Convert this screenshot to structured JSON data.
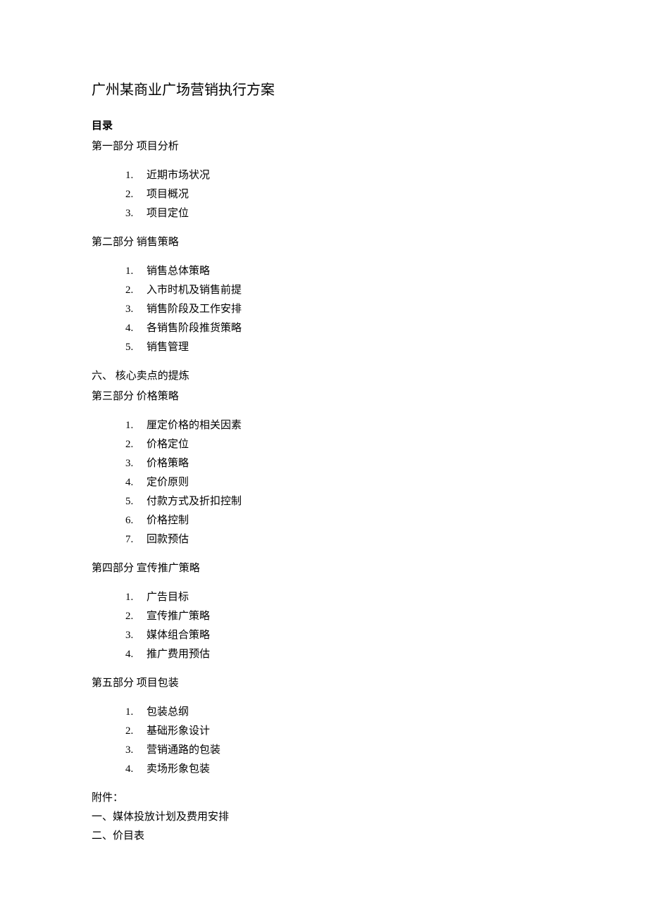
{
  "title": "广州某商业广场营销执行方案",
  "tocHeading": "目录",
  "sections": [
    {
      "heading": "第一部分 项目分析",
      "items": [
        "近期市场状况",
        "项目概况",
        "项目定位"
      ]
    },
    {
      "heading": "第二部分 销售策略",
      "items": [
        "销售总体策略",
        "入市时机及销售前提",
        "销售阶段及工作安排",
        "各销售阶段推货策略",
        "销售管理"
      ]
    }
  ],
  "extraLine": "六、 核心卖点的提炼",
  "sections2": [
    {
      "heading": "第三部分 价格策略",
      "items": [
        "厘定价格的相关因素",
        "价格定位",
        "价格策略",
        "定价原则",
        "付款方式及折扣控制",
        "价格控制",
        "回款预估"
      ]
    },
    {
      "heading": "第四部分 宣传推广策略",
      "items": [
        "广告目标",
        "宣传推广策略",
        "媒体组合策略",
        "推广费用预估"
      ]
    },
    {
      "heading": "第五部分 项目包装",
      "items": [
        "包装总纲",
        "基础形象设计",
        "营销通路的包装",
        "卖场形象包装"
      ]
    }
  ],
  "appendix": {
    "heading": "附件：",
    "items": [
      "一、媒体投放计划及费用安排",
      "二、价目表"
    ]
  }
}
